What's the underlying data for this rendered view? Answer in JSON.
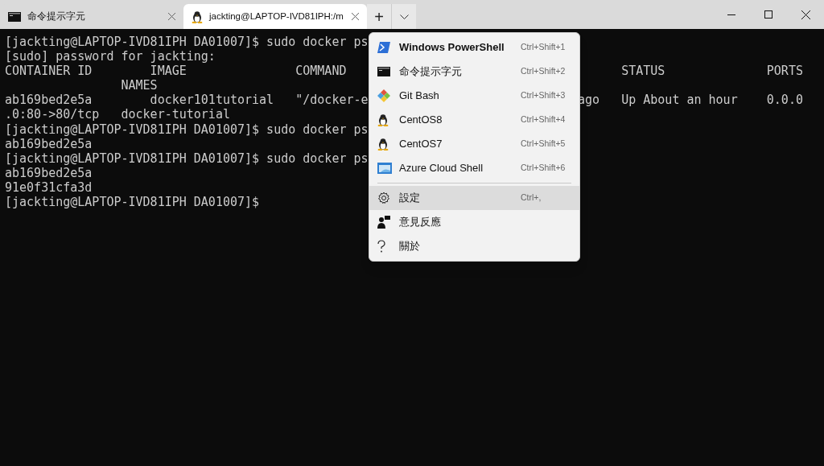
{
  "tabs": [
    {
      "title": "命令提示字元",
      "selected": false
    },
    {
      "title": "jackting@LAPTOP-IVD81IPH:/m",
      "selected": true
    }
  ],
  "new_tab_button": "+",
  "terminal_lines": [
    {
      "left": "[jackting@LAPTOP-IVD81IPH DA01007]$ sudo docker ps"
    },
    {
      "left": "[sudo] password for jackting:"
    },
    {
      "left": "CONTAINER ID        IMAGE               COMMAND",
      "right": "      STATUS              PORTS"
    },
    {
      "left": "                NAMES"
    },
    {
      "left": "ab169bed2e5a        docker101tutorial   \"/docker-e",
      "right": "ago   Up About an hour    0.0.0"
    },
    {
      "left": ".0:80->80/tcp   docker-tutorial"
    },
    {
      "left": "[jackting@LAPTOP-IVD81IPH DA01007]$ sudo docker ps"
    },
    {
      "left": "ab169bed2e5a"
    },
    {
      "left": "[jackting@LAPTOP-IVD81IPH DA01007]$ sudo docker ps"
    },
    {
      "left": "ab169bed2e5a"
    },
    {
      "left": "91e0f31cfa3d"
    },
    {
      "left": "[jackting@LAPTOP-IVD81IPH DA01007]$"
    }
  ],
  "menu": {
    "profiles": [
      {
        "label": "Windows PowerShell",
        "shortcut": "Ctrl+Shift+1",
        "default": true
      },
      {
        "label": "命令提示字元",
        "shortcut": "Ctrl+Shift+2",
        "default": false
      },
      {
        "label": "Git Bash",
        "shortcut": "Ctrl+Shift+3",
        "default": false
      },
      {
        "label": "CentOS8",
        "shortcut": "Ctrl+Shift+4",
        "default": false
      },
      {
        "label": "CentOS7",
        "shortcut": "Ctrl+Shift+5",
        "default": false
      },
      {
        "label": "Azure Cloud Shell",
        "shortcut": "Ctrl+Shift+6",
        "default": false
      }
    ],
    "actions": [
      {
        "label": "設定",
        "shortcut": "Ctrl+,",
        "highlighted": true
      },
      {
        "label": "意見反應",
        "highlighted": false
      },
      {
        "label": "關於",
        "highlighted": false
      }
    ]
  }
}
